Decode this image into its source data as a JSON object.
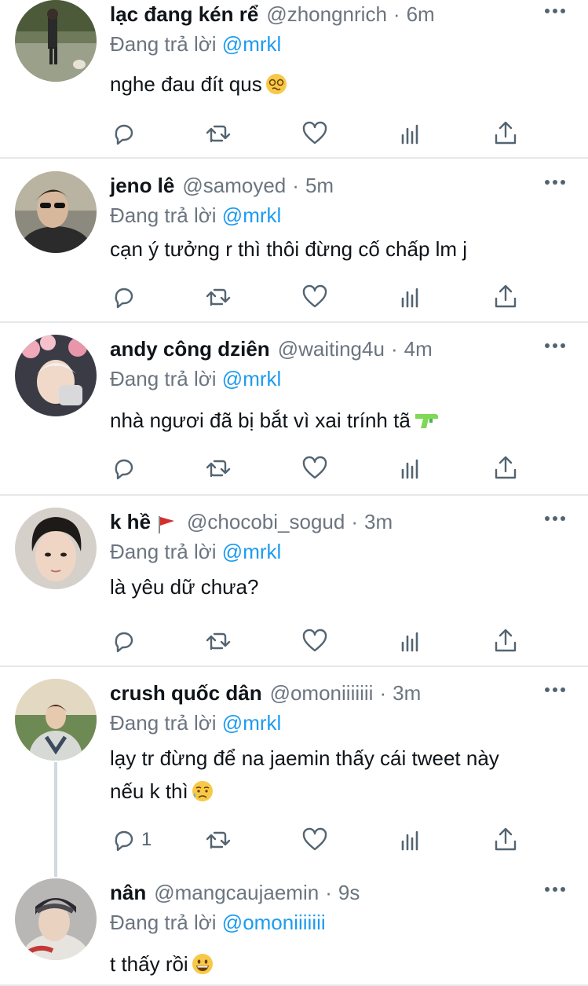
{
  "reply_prefix": "Đang trả lời",
  "tweets": [
    {
      "name": "lạc đang kén rể",
      "handle": "@zhongnrich",
      "time": "6m",
      "reply_to": "@mrkl",
      "text": "nghe đau đít qus",
      "emoji": "dizzy-face",
      "reply_count": "",
      "avatar": "person-walking-dog"
    },
    {
      "name": "jeno lê",
      "handle": "@samoyed",
      "time": "5m",
      "reply_to": "@mrkl",
      "text": "cạn ý tưởng r thì thôi đừng cố chấp lm j",
      "emoji": "",
      "reply_count": "",
      "avatar": "man-sunglasses"
    },
    {
      "name": "andy công dziên",
      "handle": "@waiting4u",
      "time": "4m",
      "reply_to": "@mrkl",
      "text": "nhà ngươi đã bị bắt vì xai trính tã",
      "emoji": "water-pistol",
      "reply_count": "",
      "avatar": "person-pink-flowers"
    },
    {
      "name": "k hề",
      "handle": "@chocobi_sogud",
      "time": "3m",
      "reply_to": "@mrkl",
      "text": "là yêu dữ chưa?",
      "emoji": "",
      "reply_count": "",
      "avatar": "young-man-portrait"
    },
    {
      "name": "crush quốc dân",
      "handle": "@omoniiiiiii",
      "time": "3m",
      "reply_to": "@mrkl",
      "text": "lạy tr đừng để na jaemin thấy cái tweet này\nnếu k thì",
      "emoji": "sad-sweat-face",
      "reply_count": "1",
      "avatar": "man-sweater-outdoors"
    },
    {
      "name": "nân",
      "handle": "@mangcaujaemin",
      "time": "9s",
      "reply_to": "@omoniiiiiii",
      "text": "t thấy rồi",
      "emoji": "grinning-face",
      "reply_count": "",
      "avatar": "young-man-hat"
    }
  ],
  "colors": {
    "link": "#1d9bf0",
    "muted": "#6b7580",
    "separator": "#e6e8ea",
    "thread": "#cfd9de"
  }
}
